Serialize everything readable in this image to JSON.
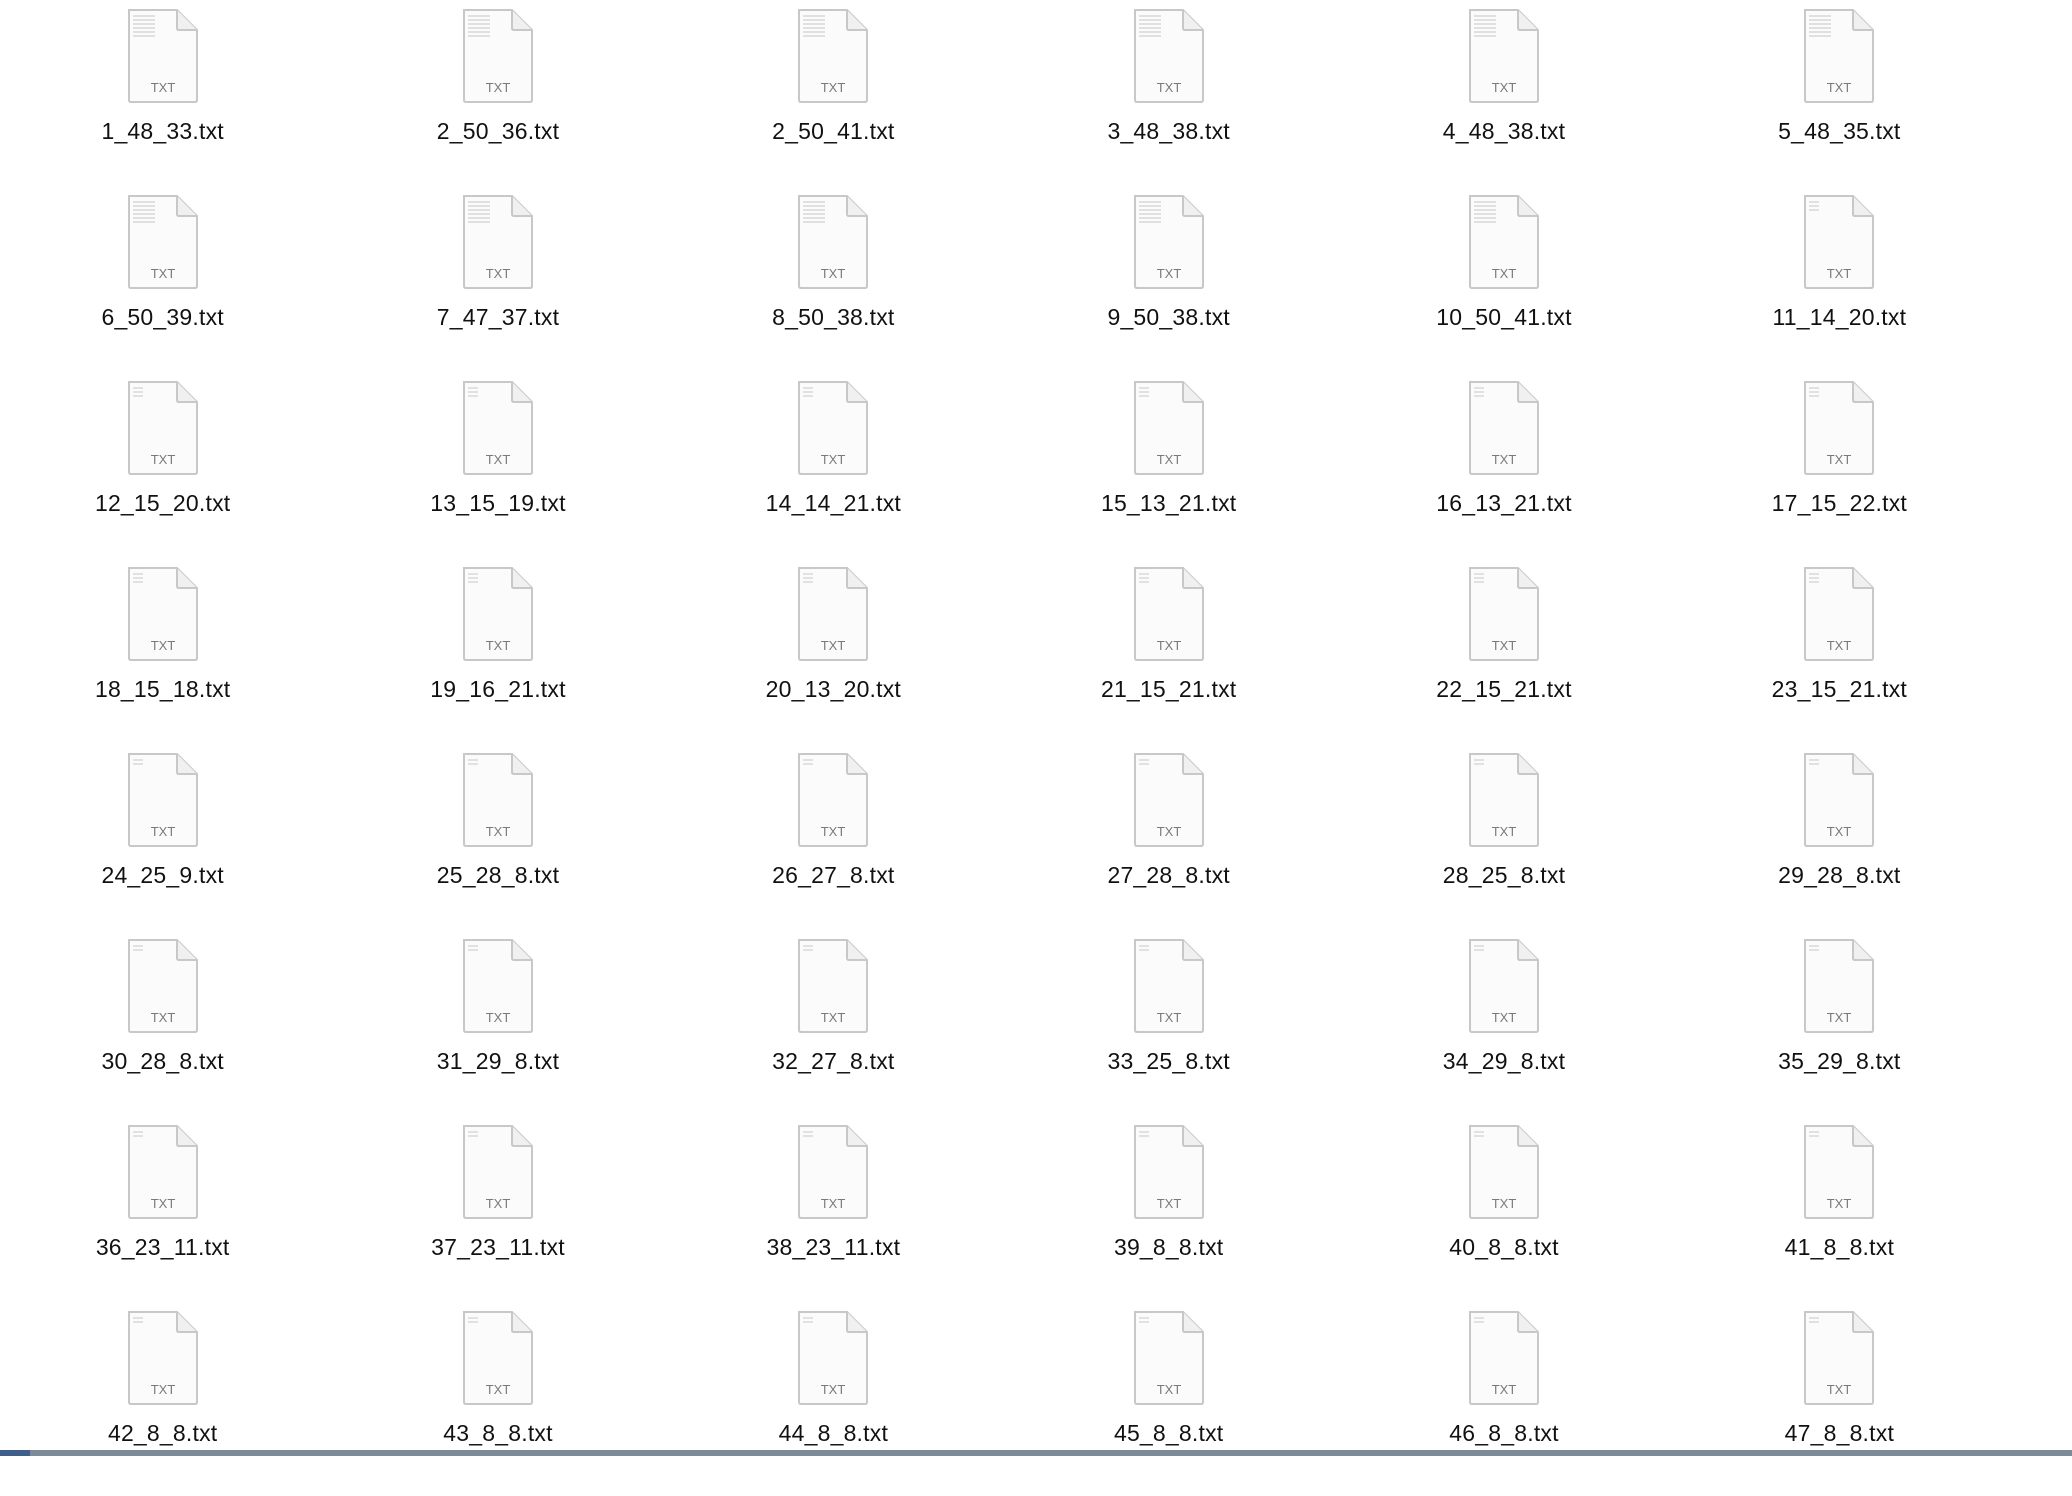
{
  "files": [
    {
      "name": "1_48_33.txt",
      "badge": "TXT"
    },
    {
      "name": "2_50_36.txt",
      "badge": "TXT"
    },
    {
      "name": "2_50_41.txt",
      "badge": "TXT"
    },
    {
      "name": "3_48_38.txt",
      "badge": "TXT"
    },
    {
      "name": "4_48_38.txt",
      "badge": "TXT"
    },
    {
      "name": "5_48_35.txt",
      "badge": "TXT"
    },
    {
      "name": "6_50_39.txt",
      "badge": "TXT"
    },
    {
      "name": "7_47_37.txt",
      "badge": "TXT"
    },
    {
      "name": "8_50_38.txt",
      "badge": "TXT"
    },
    {
      "name": "9_50_38.txt",
      "badge": "TXT"
    },
    {
      "name": "10_50_41.txt",
      "badge": "TXT"
    },
    {
      "name": "11_14_20.txt",
      "badge": "TXT"
    },
    {
      "name": "12_15_20.txt",
      "badge": "TXT"
    },
    {
      "name": "13_15_19.txt",
      "badge": "TXT"
    },
    {
      "name": "14_14_21.txt",
      "badge": "TXT"
    },
    {
      "name": "15_13_21.txt",
      "badge": "TXT"
    },
    {
      "name": "16_13_21.txt",
      "badge": "TXT"
    },
    {
      "name": "17_15_22.txt",
      "badge": "TXT"
    },
    {
      "name": "18_15_18.txt",
      "badge": "TXT"
    },
    {
      "name": "19_16_21.txt",
      "badge": "TXT"
    },
    {
      "name": "20_13_20.txt",
      "badge": "TXT"
    },
    {
      "name": "21_15_21.txt",
      "badge": "TXT"
    },
    {
      "name": "22_15_21.txt",
      "badge": "TXT"
    },
    {
      "name": "23_15_21.txt",
      "badge": "TXT"
    },
    {
      "name": "24_25_9.txt",
      "badge": "TXT"
    },
    {
      "name": "25_28_8.txt",
      "badge": "TXT"
    },
    {
      "name": "26_27_8.txt",
      "badge": "TXT"
    },
    {
      "name": "27_28_8.txt",
      "badge": "TXT"
    },
    {
      "name": "28_25_8.txt",
      "badge": "TXT"
    },
    {
      "name": "29_28_8.txt",
      "badge": "TXT"
    },
    {
      "name": "30_28_8.txt",
      "badge": "TXT"
    },
    {
      "name": "31_29_8.txt",
      "badge": "TXT"
    },
    {
      "name": "32_27_8.txt",
      "badge": "TXT"
    },
    {
      "name": "33_25_8.txt",
      "badge": "TXT"
    },
    {
      "name": "34_29_8.txt",
      "badge": "TXT"
    },
    {
      "name": "35_29_8.txt",
      "badge": "TXT"
    },
    {
      "name": "36_23_11.txt",
      "badge": "TXT"
    },
    {
      "name": "37_23_11.txt",
      "badge": "TXT"
    },
    {
      "name": "38_23_11.txt",
      "badge": "TXT"
    },
    {
      "name": "39_8_8.txt",
      "badge": "TXT"
    },
    {
      "name": "40_8_8.txt",
      "badge": "TXT"
    },
    {
      "name": "41_8_8.txt",
      "badge": "TXT"
    },
    {
      "name": "42_8_8.txt",
      "badge": "TXT"
    },
    {
      "name": "43_8_8.txt",
      "badge": "TXT"
    },
    {
      "name": "44_8_8.txt",
      "badge": "TXT"
    },
    {
      "name": "45_8_8.txt",
      "badge": "TXT"
    },
    {
      "name": "46_8_8.txt",
      "badge": "TXT"
    },
    {
      "name": "47_8_8.txt",
      "badge": "TXT"
    }
  ],
  "colors": {
    "label": "#111111",
    "icon_fill": "#fbfbfb",
    "icon_stroke": "#c8c8c8",
    "badge_text": "#7a7a7a",
    "scrollbar_track": "#7d8a97",
    "scrollbar_thumb": "#3f5f8a"
  }
}
